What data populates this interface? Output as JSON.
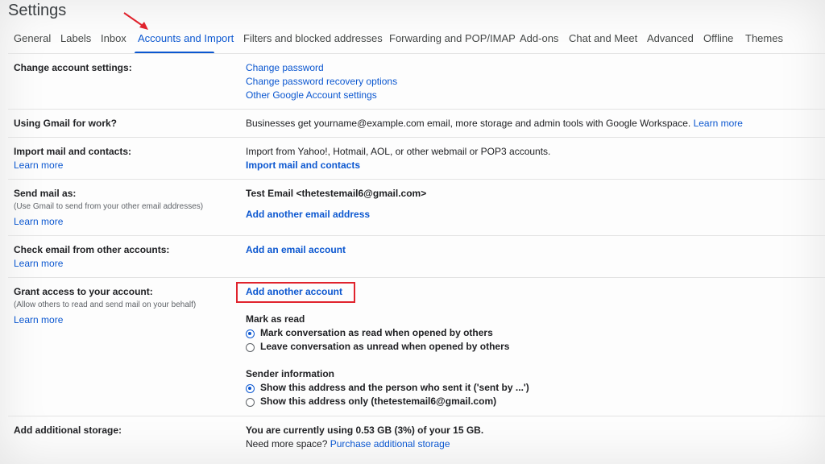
{
  "page": {
    "title": "Settings"
  },
  "tabs": [
    {
      "label": "General"
    },
    {
      "label": "Labels"
    },
    {
      "label": "Inbox"
    },
    {
      "label": "Accounts and Import"
    },
    {
      "label": "Filters and blocked addresses"
    },
    {
      "label": "Forwarding and POP/IMAP"
    },
    {
      "label": "Add-ons"
    },
    {
      "label": "Chat and Meet"
    },
    {
      "label": "Advanced"
    },
    {
      "label": "Offline"
    },
    {
      "label": "Themes"
    }
  ],
  "active_tab": "Accounts and Import",
  "sections": {
    "change_account": {
      "label": "Change account settings:",
      "links": [
        "Change password",
        "Change password recovery options",
        "Other Google Account settings"
      ]
    },
    "gmail_work": {
      "label": "Using Gmail for work?",
      "text": "Businesses get yourname@example.com email, more storage and admin tools with Google Workspace.",
      "link": "Learn more"
    },
    "import_mail": {
      "label": "Import mail and contacts:",
      "learn_more": "Learn more",
      "text": "Import from Yahoo!, Hotmail, AOL, or other webmail or POP3 accounts.",
      "action": "Import mail and contacts"
    },
    "send_mail": {
      "label": "Send mail as:",
      "sub": "(Use Gmail to send from your other email addresses)",
      "learn_more": "Learn more",
      "identity": "Test Email <thetestemail6@gmail.com>",
      "action": "Add another email address"
    },
    "check_email": {
      "label": "Check email from other accounts:",
      "learn_more": "Learn more",
      "action": "Add an email account"
    },
    "grant_access": {
      "label": "Grant access to your account:",
      "sub": "(Allow others to read and send mail on your behalf)",
      "learn_more": "Learn more",
      "action": "Add another account",
      "mark_as_read": {
        "heading": "Mark as read",
        "options": [
          {
            "label": "Mark conversation as read when opened by others",
            "checked": true
          },
          {
            "label": "Leave conversation as unread when opened by others",
            "checked": false
          }
        ]
      },
      "sender_info": {
        "heading": "Sender information",
        "options": [
          {
            "label": "Show this address and the person who sent it ('sent by ...')",
            "checked": true
          },
          {
            "label": "Show this address only (thetestemail6@gmail.com)",
            "checked": false
          }
        ]
      }
    },
    "storage": {
      "label": "Add additional storage:",
      "usage": "You are currently using 0.53 GB (3%) of your 15 GB.",
      "need_more": "Need more space?",
      "link": "Purchase additional storage"
    }
  },
  "colors": {
    "link": "#0b57d0",
    "annotation": "#e0232d"
  }
}
